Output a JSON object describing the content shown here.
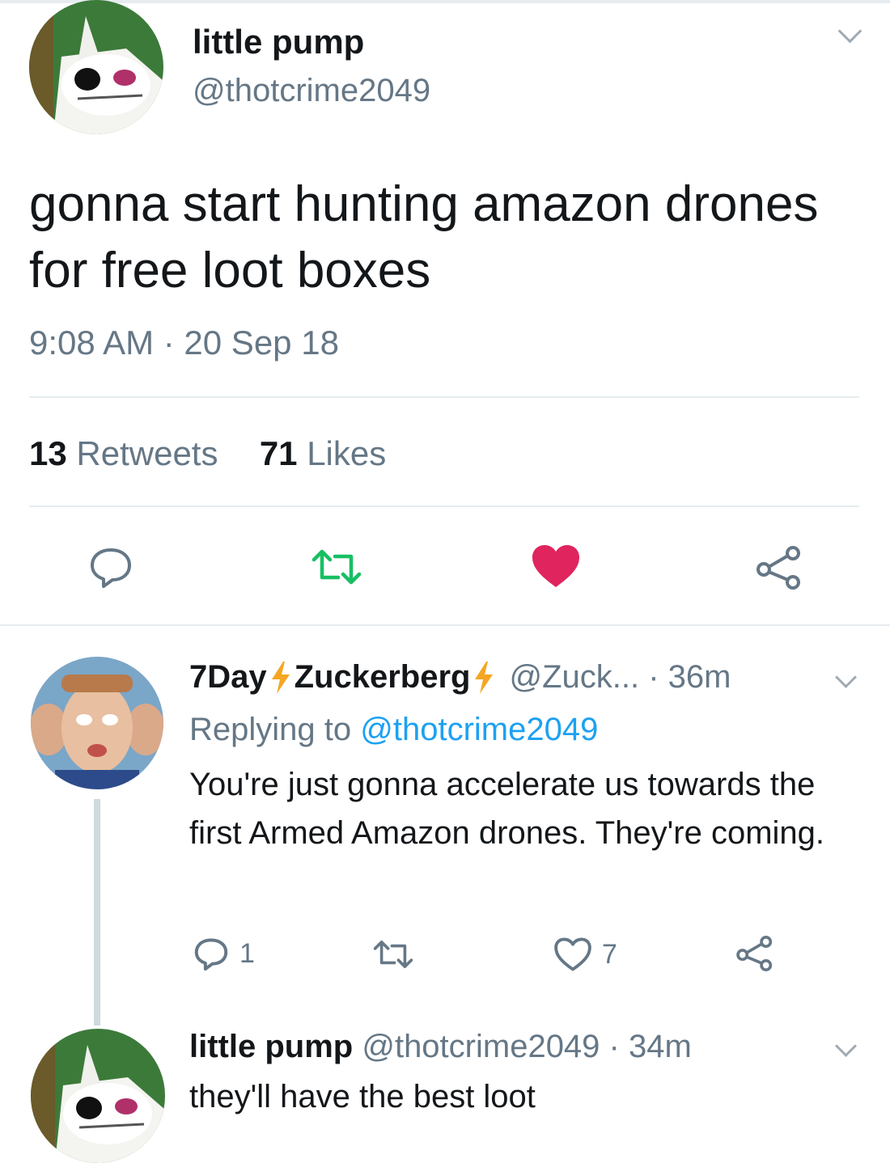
{
  "main_tweet": {
    "display_name": "little pump",
    "handle": "@thotcrime2049",
    "text": "gonna start hunting amazon drones for free loot boxes",
    "timestamp": "9:08 AM · 20 Sep 18",
    "retweets_count": "13",
    "retweets_label": "Retweets",
    "likes_count": "71",
    "likes_label": "Likes",
    "liked": true
  },
  "reply": {
    "name_part1": "7Day",
    "name_part2": "Zuckerberg",
    "handle_time": "@Zuck... · 36m",
    "replying_prefix": "Replying to",
    "replying_handle": "@thotcrime2049",
    "text": "You're just gonna accelerate us towards the first Armed Amazon drones. They're coming.",
    "reply_count": "1",
    "like_count": "7"
  },
  "reply2": {
    "display_name": "little pump",
    "handle_time": "@thotcrime2049 · 34m",
    "text": "they'll have the best loot"
  },
  "colors": {
    "like_red": "#e0245e",
    "retweet_green": "#17bf63",
    "link_blue": "#1da1f2",
    "muted_gray": "#657786",
    "bolt_orange": "#f5a623"
  },
  "icons": [
    "reply-icon",
    "retweet-icon",
    "heart-icon",
    "share-icon",
    "lightning-bolt-icon",
    "chevron-down-icon"
  ]
}
